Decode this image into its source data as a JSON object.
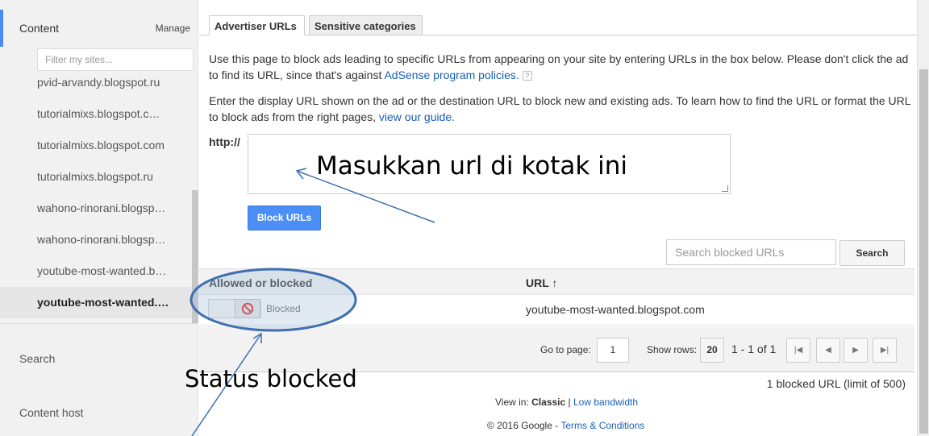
{
  "sidebar": {
    "title": "Content",
    "manage": "Manage",
    "filter_placeholder": "Filter my sites...",
    "sites": [
      "pvid-arvandy.blogspot.ru",
      "tutorialmixs.blogspot.c…",
      "tutorialmixs.blogspot.com",
      "tutorialmixs.blogspot.ru",
      "wahono-rinorani.blogsp…",
      "wahono-rinorani.blogsp…",
      "youtube-most-wanted.b…",
      "youtube-most-wanted.…"
    ],
    "nav": [
      "Search",
      "Content host"
    ]
  },
  "tabs": [
    "Advertiser URLs",
    "Sensitive categories"
  ],
  "intro": {
    "text": "Use this page to block ads leading to specific URLs from appearing on your site by entering URLs in the box below. Please don't click the ad to find its URL, since that's against ",
    "link": "AdSense program policies.",
    "help": "?"
  },
  "instructions": {
    "text": "Enter the display URL shown on the ad or the destination URL to block new and existing ads. To learn how to find the URL or format the URL to block ads from the right pages, ",
    "link": "view our guide."
  },
  "form": {
    "prefix": "http://",
    "block_button": "Block URLs",
    "search_placeholder": "Search blocked URLs",
    "search_button": "Search"
  },
  "table": {
    "headers": [
      "Allowed or blocked",
      "URL ↑"
    ],
    "rows": [
      {
        "status": "Blocked",
        "url": "youtube-most-wanted.blogspot.com"
      }
    ]
  },
  "pager": {
    "goto_label": "Go to page:",
    "page": "1",
    "show_rows_label": "Show rows:",
    "rows": "20",
    "range": "1 - 1 of 1"
  },
  "count": "1 blocked URL (limit of 500)",
  "footer": {
    "view_in": "View in: ",
    "classic": "Classic",
    "sep": " | ",
    "low_bandwidth": "Low bandwidth",
    "copyright": "© 2016 Google - ",
    "terms": "Terms & Conditions"
  },
  "annotations": {
    "url_box": "Masukkan url di kotak ini",
    "status": "Status blocked"
  },
  "colors": {
    "accent": "#4a8af4",
    "link": "#1a5fb4",
    "annotation": "#3f6fb0"
  }
}
